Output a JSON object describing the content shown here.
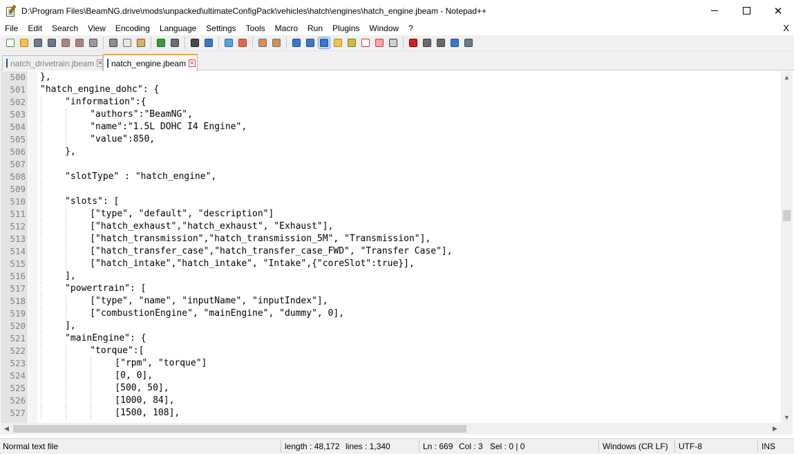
{
  "window": {
    "title": "D:\\Program Files\\BeamNG.drive\\mods\\unpacked\\ultimateConfigPack\\vehicles\\hatch\\engines\\hatch_engine.jbeam - Notepad++",
    "close_glyph": "✕"
  },
  "menu": {
    "items": [
      "File",
      "Edit",
      "Search",
      "View",
      "Encoding",
      "Language",
      "Settings",
      "Tools",
      "Macro",
      "Run",
      "Plugins",
      "Window",
      "?"
    ],
    "close_label": "X"
  },
  "toolbar": {
    "icons": [
      {
        "name": "new-file-icon",
        "color": "#ffffff",
        "accent": "#3c9a3c"
      },
      {
        "name": "open-file-icon",
        "color": "#f2c24e",
        "accent": "#b7881b"
      },
      {
        "name": "save-icon",
        "color": "#6b7a8f",
        "accent": "#3b4756"
      },
      {
        "name": "save-all-icon",
        "color": "#6b7a8f",
        "accent": "#3b4756"
      },
      {
        "name": "close-file-icon",
        "color": "#8e8e8e",
        "accent": "#d23c3c"
      },
      {
        "name": "close-all-icon",
        "color": "#8e8e8e",
        "accent": "#d23c3c"
      },
      {
        "name": "print-icon",
        "color": "#9b9b9b",
        "accent": "#4e4e4e"
      },
      {
        "name": "separator"
      },
      {
        "name": "cut-icon",
        "color": "#8f8f8f",
        "accent": "#3b3b3b"
      },
      {
        "name": "copy-icon",
        "color": "#e7e7e7",
        "accent": "#6b6b6b"
      },
      {
        "name": "paste-icon",
        "color": "#d8b46a",
        "accent": "#7a5a1a"
      },
      {
        "name": "separator"
      },
      {
        "name": "undo-icon",
        "color": "#3c9a3c",
        "accent": "#1f6a1f"
      },
      {
        "name": "redo-icon",
        "color": "#6f6f6f",
        "accent": "#3b3b3b"
      },
      {
        "name": "separator"
      },
      {
        "name": "find-icon",
        "color": "#4a4a4a",
        "accent": "#222222"
      },
      {
        "name": "replace-icon",
        "color": "#3c78c8",
        "accent": "#1c4e8c"
      },
      {
        "name": "separator"
      },
      {
        "name": "zoom-in-icon",
        "color": "#5aa0e0",
        "accent": "#1c6ab8"
      },
      {
        "name": "zoom-out-icon",
        "color": "#e06a5a",
        "accent": "#b83c1c"
      },
      {
        "name": "separator"
      },
      {
        "name": "sync-vertical-icon",
        "color": "#e98b3a",
        "accent": "#3c78c8"
      },
      {
        "name": "sync-horizontal-icon",
        "color": "#e98b3a",
        "accent": "#3c78c8"
      },
      {
        "name": "separator"
      },
      {
        "name": "word-wrap-icon",
        "color": "#3c78c8",
        "accent": "#1c4e8c"
      },
      {
        "name": "show-all-chars-icon",
        "color": "#3c78c8",
        "accent": "#1c4e8c"
      },
      {
        "name": "indent-guide-icon",
        "color": "#3c78c8",
        "accent": "#1c4e8c",
        "active": true
      },
      {
        "name": "user-language-icon",
        "color": "#f2c24e",
        "accent": "#b7881b"
      },
      {
        "name": "doc-map-icon",
        "color": "#e3b23c",
        "accent": "#3c9a3c"
      },
      {
        "name": "function-list-icon",
        "color": "#ffffff",
        "accent": "#c83c3c"
      },
      {
        "name": "folder-workspace-icon",
        "color": "#f0a4a4",
        "accent": "#c83c3c"
      },
      {
        "name": "monitoring-icon",
        "color": "#d0d0d0",
        "accent": "#3b3b3b"
      },
      {
        "name": "separator"
      },
      {
        "name": "record-macro-icon",
        "color": "#d42020",
        "accent": "#8a0000"
      },
      {
        "name": "stop-record-icon",
        "color": "#6b6b6b",
        "accent": "#3b3b3b"
      },
      {
        "name": "playback-macro-icon",
        "color": "#6b6b6b",
        "accent": "#3b3b3b"
      },
      {
        "name": "run-macro-multiple-icon",
        "color": "#3c78c8",
        "accent": "#1c4e8c"
      },
      {
        "name": "save-macro-icon",
        "color": "#6b7a8f",
        "accent": "#3b4756"
      }
    ]
  },
  "tabs": [
    {
      "label": "hatch_drivetrain.jbeam",
      "active": false
    },
    {
      "label": "hatch_engine.jbeam",
      "active": true
    }
  ],
  "editor": {
    "lines": [
      {
        "num": "500",
        "text": "},",
        "indent": 0
      },
      {
        "num": "501",
        "text": "\"hatch_engine_dohc\": {",
        "indent": 0
      },
      {
        "num": "502",
        "text": "\"information\":{",
        "indent": 1
      },
      {
        "num": "503",
        "text": "\"authors\":\"BeamNG\",",
        "indent": 2
      },
      {
        "num": "504",
        "text": "\"name\":\"1.5L DOHC I4 Engine\",",
        "indent": 2
      },
      {
        "num": "505",
        "text": "\"value\":850,",
        "indent": 2
      },
      {
        "num": "506",
        "text": "},",
        "indent": 1
      },
      {
        "num": "507",
        "text": "",
        "indent": 1
      },
      {
        "num": "508",
        "text": "\"slotType\" : \"hatch_engine\",",
        "indent": 1
      },
      {
        "num": "509",
        "text": "",
        "indent": 1
      },
      {
        "num": "510",
        "text": "\"slots\": [",
        "indent": 1
      },
      {
        "num": "511",
        "text": "[\"type\", \"default\", \"description\"]",
        "indent": 2
      },
      {
        "num": "512",
        "text": "[\"hatch_exhaust\",\"hatch_exhaust\", \"Exhaust\"],",
        "indent": 2
      },
      {
        "num": "513",
        "text": "[\"hatch_transmission\",\"hatch_transmission_5M\", \"Transmission\"],",
        "indent": 2
      },
      {
        "num": "514",
        "text": "[\"hatch_transfer_case\",\"hatch_transfer_case_FWD\", \"Transfer Case\"],",
        "indent": 2
      },
      {
        "num": "515",
        "text": "[\"hatch_intake\",\"hatch_intake\", \"Intake\",{\"coreSlot\":true}],",
        "indent": 2
      },
      {
        "num": "516",
        "text": "],",
        "indent": 1
      },
      {
        "num": "517",
        "text": "\"powertrain\": [",
        "indent": 1
      },
      {
        "num": "518",
        "text": "[\"type\", \"name\", \"inputName\", \"inputIndex\"],",
        "indent": 2
      },
      {
        "num": "519",
        "text": "[\"combustionEngine\", \"mainEngine\", \"dummy\", 0],",
        "indent": 2
      },
      {
        "num": "520",
        "text": "],",
        "indent": 1
      },
      {
        "num": "521",
        "text": "\"mainEngine\": {",
        "indent": 1
      },
      {
        "num": "522",
        "text": "\"torque\":[",
        "indent": 2
      },
      {
        "num": "523",
        "text": "[\"rpm\", \"torque\"]",
        "indent": 3
      },
      {
        "num": "524",
        "text": "[0, 0],",
        "indent": 3
      },
      {
        "num": "525",
        "text": "[500, 50],",
        "indent": 3
      },
      {
        "num": "526",
        "text": "[1000, 84],",
        "indent": 3
      },
      {
        "num": "527",
        "text": "[1500, 108],",
        "indent": 3
      }
    ]
  },
  "scrollbars": {
    "vertical_position": 0.4,
    "horizontal_visible_fraction": 0.6
  },
  "statusbar": {
    "file_type": "Normal text file",
    "length": "length : 48,172",
    "lines": "lines : 1,340",
    "ln": "Ln : 669",
    "col": "Col : 3",
    "sel": "Sel : 0 | 0",
    "eol": "Windows (CR LF)",
    "encoding": "UTF-8",
    "mode": "INS"
  }
}
